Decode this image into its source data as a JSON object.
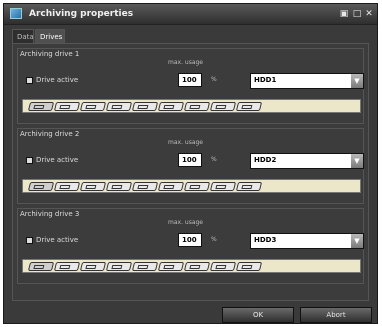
{
  "window": {
    "title": "Archiving properties",
    "icon": "archive-app-icon"
  },
  "titlebar_buttons": [
    "minimize-icon",
    "maximize-icon",
    "close-icon"
  ],
  "tabs": [
    {
      "label": "Data"
    },
    {
      "label": "Drives"
    }
  ],
  "drives": [
    {
      "title": "Archiving drive 1",
      "max_usage_label": "max. usage",
      "active_label": "Drive active",
      "usage": "100",
      "unit": "%",
      "drive": "HDD1"
    },
    {
      "title": "Archiving drive 2",
      "max_usage_label": "max. usage",
      "active_label": "Drive active",
      "usage": "100",
      "unit": "%",
      "drive": "HDD2"
    },
    {
      "title": "Archiving drive 3",
      "max_usage_label": "max. usage",
      "active_label": "Drive active",
      "usage": "100",
      "unit": "%",
      "drive": "HDD3"
    }
  ],
  "buttons": {
    "ok": "OK",
    "abort": "Abort"
  }
}
